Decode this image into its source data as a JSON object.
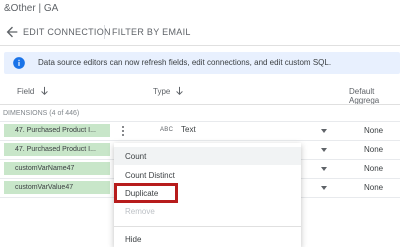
{
  "window": {
    "title": "&Other | GA"
  },
  "toolbar": {
    "edit_connection": "EDIT CONNECTION",
    "filter_by_email": "FILTER BY EMAIL"
  },
  "banner": {
    "text": "Data source editors can now refresh fields, edit connections, and edit custom SQL."
  },
  "columns": {
    "field": "Field",
    "type": "Type",
    "default_aggregation": "Default Aggrega"
  },
  "dimensions_label": "DIMENSIONS (4 of 446)",
  "rows": [
    {
      "field": "47. Purchased Product I...",
      "type_icon": "ABC",
      "type": "Text",
      "aggregation": "None"
    },
    {
      "field": "47. Purchased Product I...",
      "aggregation": "None"
    },
    {
      "field": "customVarName47",
      "aggregation": "None"
    },
    {
      "field": "customVarValue47",
      "aggregation": "None"
    }
  ],
  "context_menu": {
    "items": [
      {
        "label": "Count",
        "disabled": false
      },
      {
        "label": "Count Distinct",
        "disabled": false
      },
      {
        "label": "Duplicate",
        "disabled": false,
        "highlighted": true
      },
      {
        "label": "Remove",
        "disabled": true
      },
      {
        "label": "Hide",
        "disabled": false
      }
    ]
  },
  "colors": {
    "accent_blue": "#1a73e8",
    "chip_green": "#c8e6c9",
    "highlight_red": "#b71c1c",
    "banner_bg": "#e8f0fe"
  },
  "icons": {
    "back": "arrow-back-icon",
    "info": "info-icon",
    "sort": "arrow-down-icon",
    "menu": "more-vert-icon",
    "dropdown": "caret-down-icon"
  }
}
